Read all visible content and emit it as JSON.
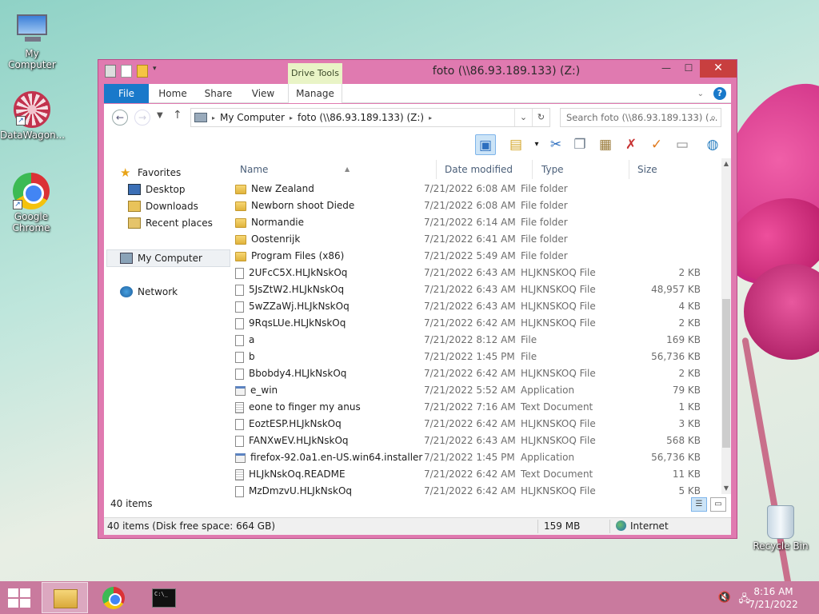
{
  "desktop": {
    "icons": [
      {
        "label": "My Computer",
        "icon": "computer-icon"
      },
      {
        "label": "DataWagon...",
        "icon": "datawagon-icon"
      },
      {
        "label": "Google Chrome",
        "icon": "chrome-icon"
      },
      {
        "label": "Recycle Bin",
        "icon": "recycle-bin-icon"
      }
    ]
  },
  "window": {
    "title": "foto (\\\\86.93.189.133) (Z:)",
    "context_tab": "Drive Tools",
    "controls": {
      "minimize": "—",
      "maximize": "☐",
      "close": "✕"
    }
  },
  "ribbon": {
    "tabs": [
      "File",
      "Home",
      "Share",
      "View",
      "Manage"
    ]
  },
  "address": {
    "back": "←",
    "forward": "→",
    "up": "↑",
    "crumbs": [
      "My Computer",
      "foto (\\\\86.93.189.133) (Z:)"
    ],
    "search_placeholder": "Search foto (\\\\86.93.189.133) (..."
  },
  "navpane": {
    "favorites": "Favorites",
    "favorites_items": [
      "Desktop",
      "Downloads",
      "Recent places"
    ],
    "computer": "My Computer",
    "network": "Network"
  },
  "columns": {
    "name": "Name",
    "date": "Date modified",
    "type": "Type",
    "size": "Size"
  },
  "files": [
    {
      "name": "New Zealand",
      "date": "7/21/2022 6:08 AM",
      "type": "File folder",
      "size": "",
      "icon": "folder"
    },
    {
      "name": "Newborn shoot Diede",
      "date": "7/21/2022 6:08 AM",
      "type": "File folder",
      "size": "",
      "icon": "folder"
    },
    {
      "name": "Normandie",
      "date": "7/21/2022 6:14 AM",
      "type": "File folder",
      "size": "",
      "icon": "folder"
    },
    {
      "name": "Oostenrijk",
      "date": "7/21/2022 6:41 AM",
      "type": "File folder",
      "size": "",
      "icon": "folder"
    },
    {
      "name": "Program Files (x86)",
      "date": "7/21/2022 5:49 AM",
      "type": "File folder",
      "size": "",
      "icon": "folder"
    },
    {
      "name": "2UFcC5X.HLJkNskOq",
      "date": "7/21/2022 6:43 AM",
      "type": "HLJKNSKOQ File",
      "size": "2 KB",
      "icon": "doc"
    },
    {
      "name": "5JsZtW2.HLJkNskOq",
      "date": "7/21/2022 6:43 AM",
      "type": "HLJKNSKOQ File",
      "size": "48,957 KB",
      "icon": "doc"
    },
    {
      "name": "5wZZaWj.HLJkNskOq",
      "date": "7/21/2022 6:43 AM",
      "type": "HLJKNSKOQ File",
      "size": "4 KB",
      "icon": "doc"
    },
    {
      "name": "9RqsLUe.HLJkNskOq",
      "date": "7/21/2022 6:42 AM",
      "type": "HLJKNSKOQ File",
      "size": "2 KB",
      "icon": "doc"
    },
    {
      "name": "a",
      "date": "7/21/2022 8:12 AM",
      "type": "File",
      "size": "169 KB",
      "icon": "doc"
    },
    {
      "name": "b",
      "date": "7/21/2022 1:45 PM",
      "type": "File",
      "size": "56,736 KB",
      "icon": "doc"
    },
    {
      "name": "Bbobdy4.HLJkNskOq",
      "date": "7/21/2022 6:42 AM",
      "type": "HLJKNSKOQ File",
      "size": "2 KB",
      "icon": "doc"
    },
    {
      "name": "e_win",
      "date": "7/21/2022 5:52 AM",
      "type": "Application",
      "size": "79 KB",
      "icon": "app"
    },
    {
      "name": "eone to finger my anus",
      "date": "7/21/2022 7:16 AM",
      "type": "Text Document",
      "size": "1 KB",
      "icon": "txt"
    },
    {
      "name": "EoztESP.HLJkNskOq",
      "date": "7/21/2022 6:42 AM",
      "type": "HLJKNSKOQ File",
      "size": "3 KB",
      "icon": "doc"
    },
    {
      "name": "FANXwEV.HLJkNskOq",
      "date": "7/21/2022 6:43 AM",
      "type": "HLJKNSKOQ File",
      "size": "568 KB",
      "icon": "doc"
    },
    {
      "name": "firefox-92.0a1.en-US.win64.installer",
      "date": "7/21/2022 1:45 PM",
      "type": "Application",
      "size": "56,736 KB",
      "icon": "app"
    },
    {
      "name": "HLJkNskOq.README",
      "date": "7/21/2022 6:42 AM",
      "type": "Text Document",
      "size": "11 KB",
      "icon": "txt"
    },
    {
      "name": "MzDmzvU.HLJkNskOq",
      "date": "7/21/2022 6:42 AM",
      "type": "HLJKNSKOQ File",
      "size": "5 KB",
      "icon": "doc"
    }
  ],
  "item_count": "40 items",
  "status": {
    "left": "40 items (Disk free space: 664 GB)",
    "size": "159 MB",
    "zone": "Internet"
  },
  "taskbar": {
    "time": "8:16 AM",
    "date": "7/21/2022"
  }
}
